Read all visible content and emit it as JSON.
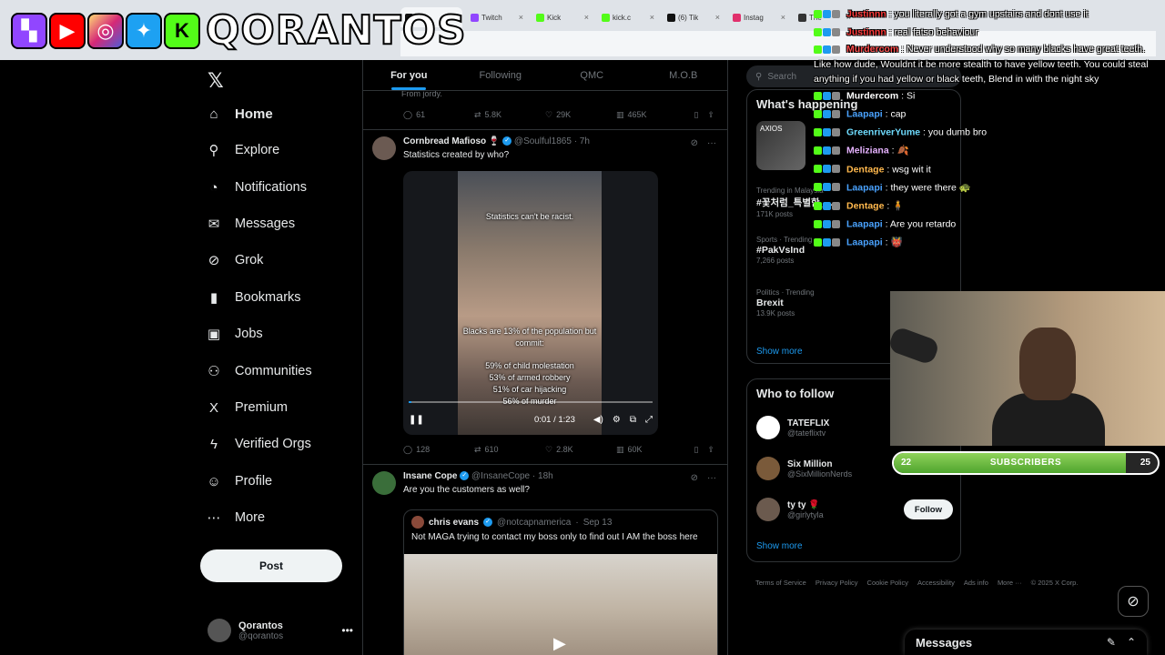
{
  "browser": {
    "tabs": [
      {
        "label": "Ho",
        "active": true,
        "color": "#111111"
      },
      {
        "label": "Twitch",
        "color": "#9146ff"
      },
      {
        "label": "Kick",
        "color": "#53fc18"
      },
      {
        "label": "kick.c",
        "color": "#53fc18"
      },
      {
        "label": "(6) Tik",
        "color": "#111111"
      },
      {
        "label": "Instag",
        "color": "#e1306c"
      },
      {
        "label": "The",
        "color": "#333333"
      }
    ]
  },
  "overlay": {
    "brand": "QORANTOS",
    "socials": [
      "twitch-icon",
      "youtube-icon",
      "instagram-icon",
      "twitter-icon",
      "kick-icon"
    ]
  },
  "sidebar": {
    "items": [
      {
        "name": "home",
        "label": "Home",
        "icon": "⌂"
      },
      {
        "name": "explore",
        "label": "Explore",
        "icon": "⚲"
      },
      {
        "name": "notifications",
        "label": "Notifications",
        "icon": "◔"
      },
      {
        "name": "messages",
        "label": "Messages",
        "icon": "✉"
      },
      {
        "name": "grok",
        "label": "Grok",
        "icon": "⊘"
      },
      {
        "name": "bookmarks",
        "label": "Bookmarks",
        "icon": "▮"
      },
      {
        "name": "jobs",
        "label": "Jobs",
        "icon": "▣"
      },
      {
        "name": "communities",
        "label": "Communities",
        "icon": "⚇"
      },
      {
        "name": "premium",
        "label": "Premium",
        "icon": "X"
      },
      {
        "name": "verified-orgs",
        "label": "Verified Orgs",
        "icon": "ϟ"
      },
      {
        "name": "profile",
        "label": "Profile",
        "icon": "☺"
      },
      {
        "name": "more",
        "label": "More",
        "icon": "⋯"
      }
    ],
    "post_label": "Post",
    "account": {
      "name": "Qorantos",
      "handle": "@qorantos"
    }
  },
  "feed": {
    "tabs": [
      "For you",
      "Following",
      "QMC",
      "M.O.B"
    ],
    "prev_tail": "From jordy.",
    "prev_actions": {
      "replies": "61",
      "reposts": "5.8K",
      "likes": "29K",
      "views": "465K"
    },
    "post1": {
      "name": "Cornbread Mafioso",
      "emoji": "🍷",
      "handle": "@Soulful1865",
      "time": "7h",
      "text": "Statistics created by who?",
      "video": {
        "caption_top": "Statistics can't be racist.",
        "caption_mid": "Blacks are 13% of the population but commit:",
        "stats": [
          "59% of child molestation",
          "53% of armed robbery",
          "51% of car hijacking",
          "56% of murder"
        ],
        "time": "0:01 / 1:23",
        "progress": 0.012
      },
      "actions": {
        "replies": "128",
        "reposts": "610",
        "likes": "2.8K",
        "views": "60K"
      }
    },
    "post2": {
      "name": "Insane Cope",
      "handle": "@InsaneCope",
      "time": "18h",
      "text": "Are you the customers as well?",
      "quote": {
        "name": "chris evans",
        "handle": "@notcapnamerica",
        "time": "Sep 13",
        "text": "Not MAGA trying to contact my boss only to find out I AM the boss here"
      }
    }
  },
  "right": {
    "search_placeholder": "Search",
    "happening_title": "What's happening",
    "thumb_label": "AXIOS",
    "trends": [
      {
        "ctx": "Trending in Malaysia",
        "title": "#꽃처럼_특별한_...",
        "count": "171K posts"
      },
      {
        "ctx": "Sports · Trending",
        "title": "#PakVsInd",
        "count": "7,266 posts"
      },
      {
        "ctx": "Politics · Trending",
        "title": "Brexit",
        "count": "13.9K posts"
      }
    ],
    "show_more": "Show more",
    "who_to_follow_title": "Who to follow",
    "follow": [
      {
        "name": "TATEFLIX",
        "handle": "@tateflixtv",
        "color": "#ffffff"
      },
      {
        "name": "Six Million",
        "handle": "@SixMillionNerds",
        "color": "#7a5a3a"
      },
      {
        "name": "ty ty 🌹",
        "handle": "@girlytyla",
        "color": "#6b5a4e"
      }
    ],
    "follow_button": "Follow",
    "footer": [
      "Terms of Service",
      "Privacy Policy",
      "Cookie Policy",
      "Accessibility",
      "Ads info",
      "More ···",
      "© 2025 X Corp."
    ]
  },
  "chat": [
    {
      "user": "Justinnn",
      "color": "#ff3b3b",
      "text": "you literally got a gym upstairs and dont use it"
    },
    {
      "user": "Justinnn",
      "color": "#ff3b3b",
      "text": "real fatso behaviour"
    },
    {
      "user": "Murdercom",
      "color": "#ff4d4d",
      "text": "Never understood why so many blacks have great teeth. Like how dude, Wouldnt it be more stealth to have yellow teeth. You could steal anything if you had yellow or black teeth, Blend in with the night sky",
      "wrap": true
    },
    {
      "user": "Murdercom",
      "color": "#ffffff",
      "text": "Si"
    },
    {
      "user": "Laapapi",
      "color": "#4aa3ff",
      "text": "cap"
    },
    {
      "user": "GreenriverYume",
      "color": "#6fdcff",
      "text": "you dumb bro"
    },
    {
      "user": "Meliziana",
      "color": "#e6b3ff",
      "text": "🍂"
    },
    {
      "user": "Dentage",
      "color": "#ffb84d",
      "text": "wsg wit it"
    },
    {
      "user": "Laapapi",
      "color": "#4aa3ff",
      "text": "they were there 🐢"
    },
    {
      "user": "Dentage",
      "color": "#ffb84d",
      "text": "🧍"
    },
    {
      "user": "Laapapi",
      "color": "#4aa3ff",
      "text": "Are you retardo"
    },
    {
      "user": "Laapapi",
      "color": "#4aa3ff",
      "text": "👹"
    }
  ],
  "subgoal": {
    "current": "22",
    "label": "SUBSCRIBERS",
    "goal": "25",
    "fraction": 0.88
  },
  "dock": {
    "title": "Messages"
  },
  "colors": {
    "accent": "#1d9bf0",
    "bg": "#000000",
    "border": "#2f3336"
  }
}
